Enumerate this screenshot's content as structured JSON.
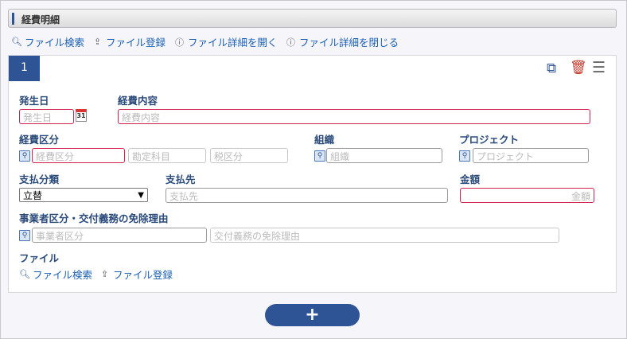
{
  "header": {
    "title": "経費明細"
  },
  "toolbar": {
    "file_search": "ファイル検索",
    "file_register": "ファイル登録",
    "open_details": "ファイル詳細を開く",
    "close_details": "ファイル詳細を閉じる"
  },
  "card": {
    "index": "1",
    "fields": {
      "date": {
        "label": "発生日",
        "placeholder": "発生日"
      },
      "content": {
        "label": "経費内容",
        "placeholder": "経費内容"
      },
      "expense_type": {
        "label": "経費区分",
        "placeholder": "経費区分",
        "account_placeholder": "勘定科目",
        "tax_placeholder": "税区分"
      },
      "org": {
        "label": "組織",
        "placeholder": "組織"
      },
      "project": {
        "label": "プロジェクト",
        "placeholder": "プロジェクト"
      },
      "pay_class": {
        "label": "支払分類",
        "value": "立替"
      },
      "payee": {
        "label": "支払先",
        "placeholder": "支払先"
      },
      "amount": {
        "label": "金額",
        "placeholder": "金額"
      },
      "business": {
        "label": "事業者区分・交付義務の免除理由",
        "placeholder": "事業者区分",
        "reason_placeholder": "交付義務の免除理由"
      },
      "file": {
        "label": "ファイル",
        "search": "ファイル検索",
        "register": "ファイル登録"
      }
    }
  },
  "colors": {
    "accent": "#2f5496",
    "required": "#d4204c",
    "link": "#1a5fb4",
    "delete": "#c0392b"
  }
}
